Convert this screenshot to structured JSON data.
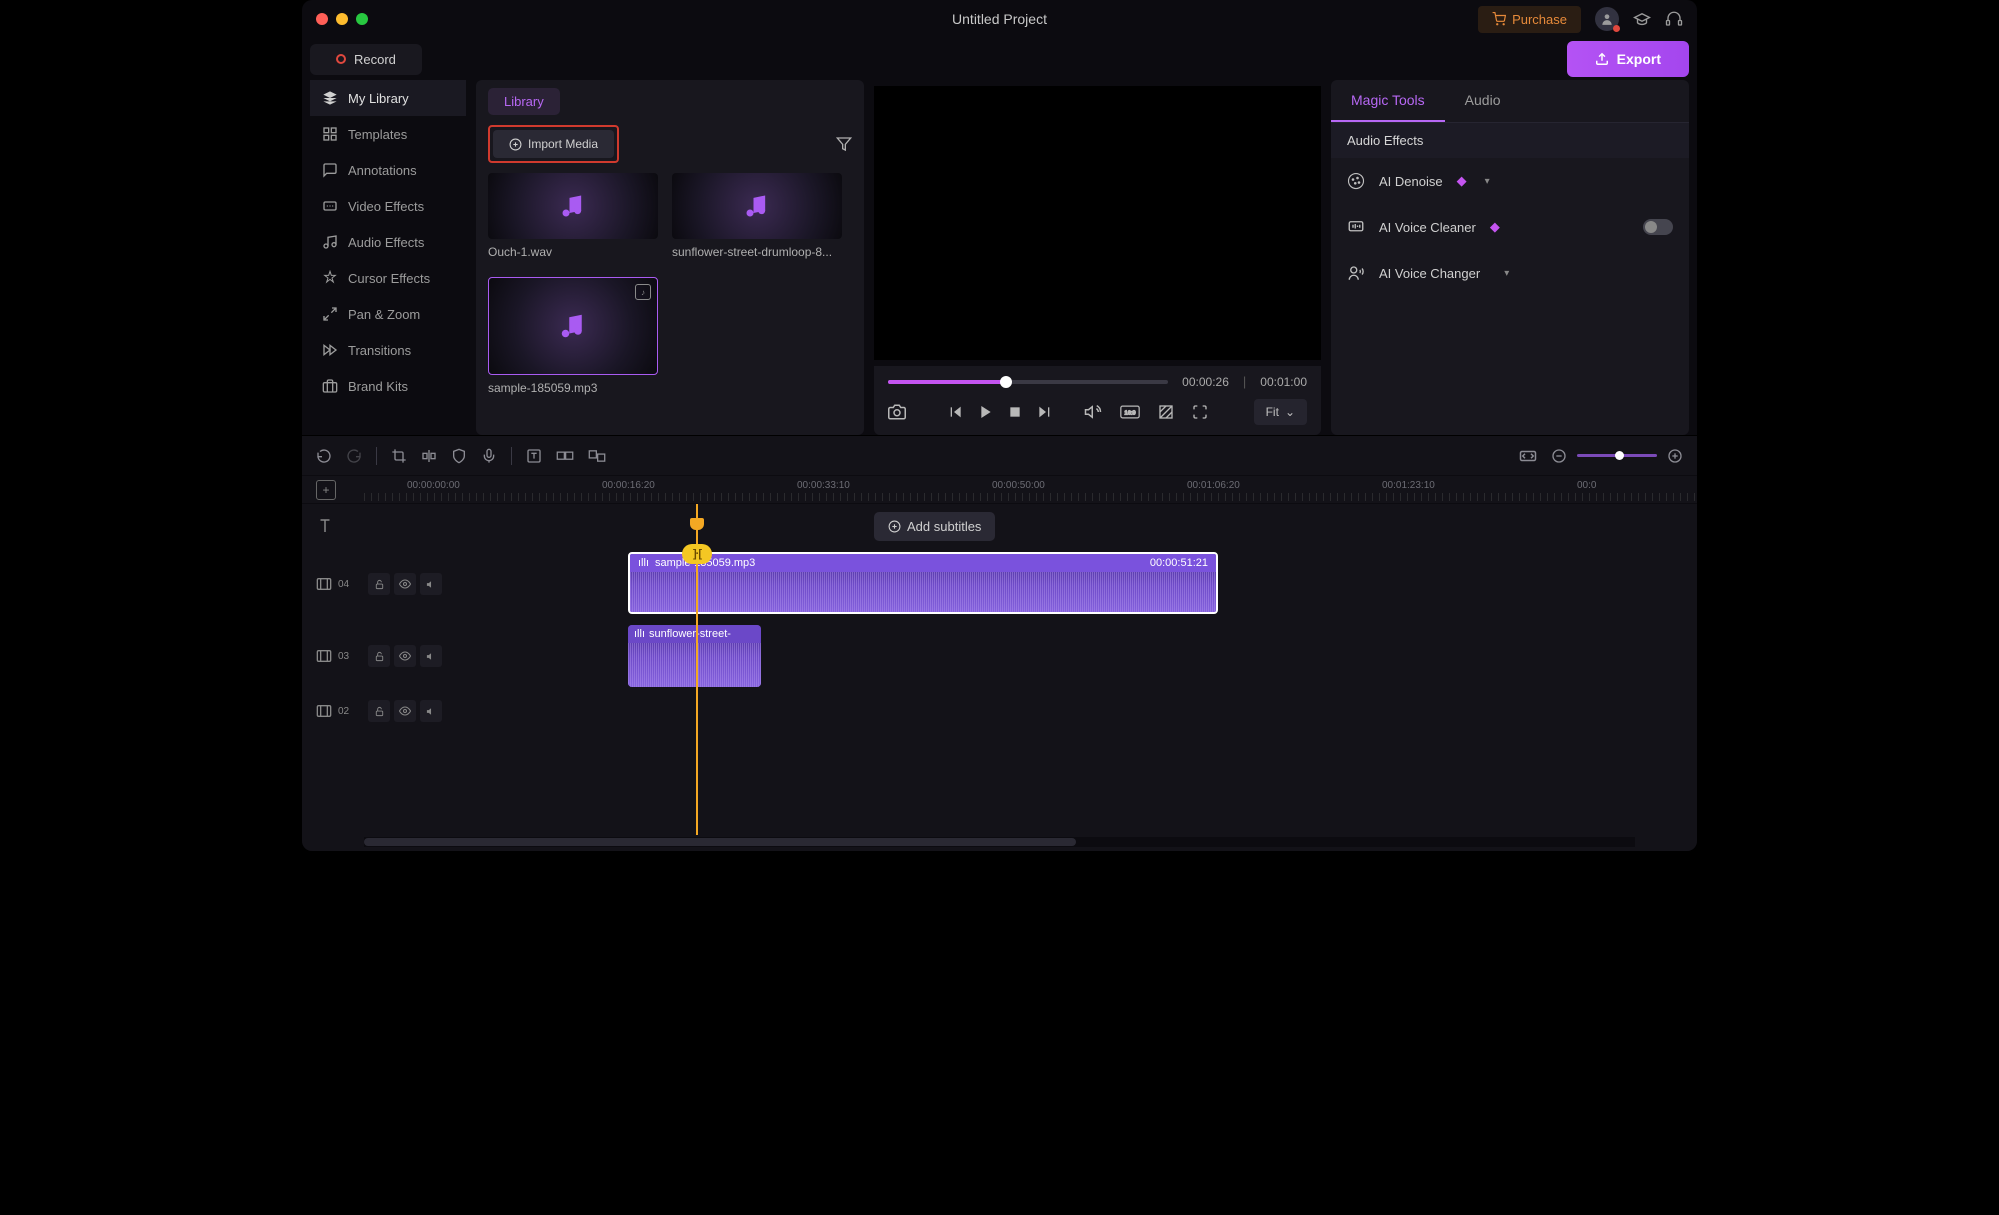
{
  "titlebar": {
    "title": "Untitled Project",
    "purchase": "Purchase"
  },
  "topbar": {
    "record": "Record",
    "export": "Export"
  },
  "sidebar": {
    "items": [
      {
        "label": "My Library"
      },
      {
        "label": "Templates"
      },
      {
        "label": "Annotations"
      },
      {
        "label": "Video Effects"
      },
      {
        "label": "Audio Effects"
      },
      {
        "label": "Cursor Effects"
      },
      {
        "label": "Pan & Zoom"
      },
      {
        "label": "Transitions"
      },
      {
        "label": "Brand Kits"
      }
    ]
  },
  "library": {
    "tab": "Library",
    "import": "Import Media",
    "items": [
      {
        "name": "Ouch-1.wav"
      },
      {
        "name": "sunflower-street-drumloop-8..."
      },
      {
        "name": "sample-185059.mp3"
      }
    ]
  },
  "preview": {
    "current": "00:00:26",
    "total": "00:01:00",
    "fit": "Fit"
  },
  "magic": {
    "tabs": [
      "Magic Tools",
      "Audio"
    ],
    "section": "Audio Effects",
    "items": [
      {
        "label": "AI Denoise",
        "gem": true,
        "chev": true
      },
      {
        "label": "AI Voice Cleaner",
        "gem": true,
        "toggle": true
      },
      {
        "label": "AI Voice Changer",
        "chev": true
      }
    ]
  },
  "timeline": {
    "subtitles": "Add subtitles",
    "ticks": [
      "00:00:00:00",
      "00:00:16:20",
      "00:00:33:10",
      "00:00:50:00",
      "00:01:06:20",
      "00:01:23:10",
      "00:0"
    ],
    "tracks": [
      "04",
      "03",
      "02"
    ],
    "clips": {
      "audio1": {
        "name": "sample-185059.mp3",
        "duration": "00:00:51:21"
      },
      "audio2": {
        "name": "sunflower-street-"
      }
    }
  }
}
